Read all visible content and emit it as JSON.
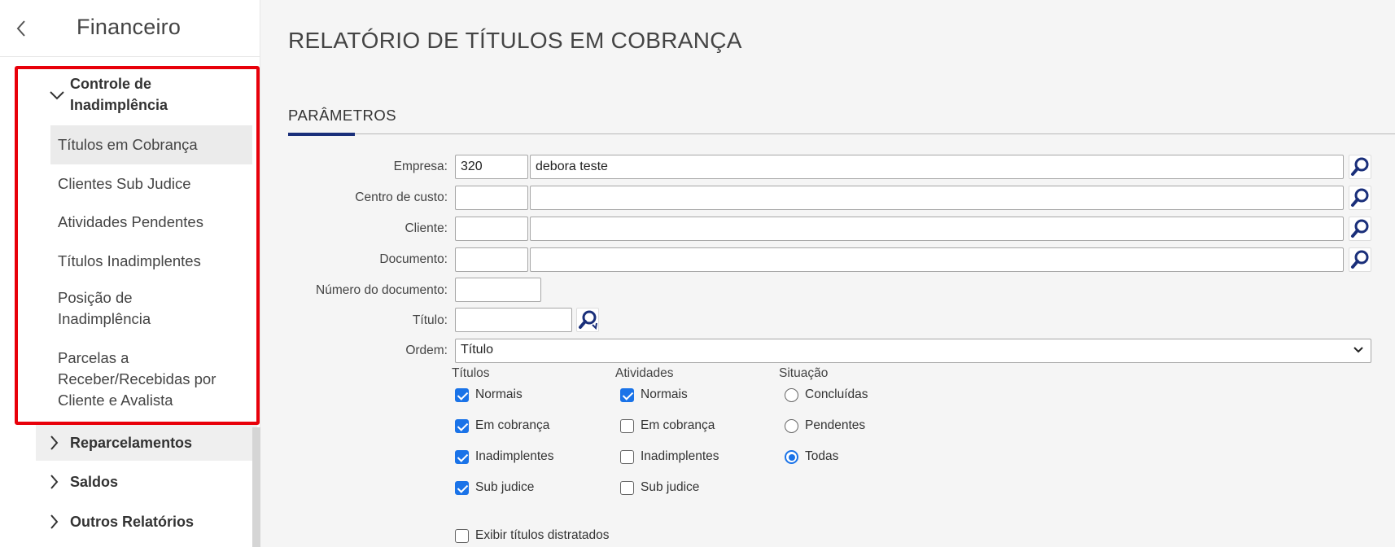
{
  "sidebar": {
    "title": "Financeiro",
    "groups": [
      {
        "label_lines": [
          "Controle de",
          "Inadimplência"
        ],
        "expanded": true,
        "items": [
          {
            "lines": [
              "Títulos em Cobrança"
            ],
            "active": true
          },
          {
            "lines": [
              "Clientes Sub Judice"
            ]
          },
          {
            "lines": [
              "Atividades Pendentes"
            ]
          },
          {
            "lines": [
              "Títulos Inadimplentes"
            ]
          },
          {
            "lines": [
              "Posição de",
              "Inadimplência"
            ]
          },
          {
            "lines": [
              "Parcelas a",
              "Receber/Recebidas por",
              "Cliente e Avalista"
            ]
          }
        ]
      },
      {
        "label": "Reparcelamentos",
        "expanded": false
      },
      {
        "label": "Saldos",
        "expanded": false
      },
      {
        "label": "Outros Relatórios",
        "expanded": false
      }
    ]
  },
  "main": {
    "title": "RELATÓRIO DE TÍTULOS EM COBRANÇA",
    "tab": "PARÂMETROS",
    "fields": {
      "empresa": {
        "label": "Empresa:",
        "code": "320",
        "name": "debora teste"
      },
      "centro_custo": {
        "label": "Centro de custo:",
        "code": "",
        "name": ""
      },
      "cliente": {
        "label": "Cliente:",
        "code": "",
        "name": ""
      },
      "documento": {
        "label": "Documento:",
        "code": "",
        "name": ""
      },
      "numero_documento": {
        "label": "Número do documento:",
        "value": ""
      },
      "titulo": {
        "label": "Título:",
        "value": ""
      },
      "ordem": {
        "label": "Ordem:",
        "value": "Título"
      }
    },
    "titulos": {
      "header": "Títulos",
      "options": [
        {
          "label": "Normais",
          "checked": true
        },
        {
          "label": "Em cobrança",
          "checked": true
        },
        {
          "label": "Inadimplentes",
          "checked": true
        },
        {
          "label": "Sub judice",
          "checked": true
        }
      ]
    },
    "atividades": {
      "header": "Atividades",
      "options": [
        {
          "label": "Normais",
          "checked": true
        },
        {
          "label": "Em cobrança",
          "checked": false
        },
        {
          "label": "Inadimplentes",
          "checked": false
        },
        {
          "label": "Sub judice",
          "checked": false
        }
      ]
    },
    "situacao": {
      "header": "Situação",
      "options": [
        {
          "label": "Concluídas",
          "selected": false
        },
        {
          "label": "Pendentes",
          "selected": false
        },
        {
          "label": "Todas",
          "selected": true
        }
      ]
    },
    "exibir_distratados": {
      "label": "Exibir títulos distratados",
      "checked": false
    }
  },
  "colors": {
    "accent": "#1a2f7a",
    "checkbox": "#1a73e8",
    "highlight_border": "#e8000a",
    "lupa_icon": "#1a2f7a"
  },
  "icons": {
    "back": "chevron-left-icon",
    "lookup": "magnifier-icon",
    "title_lookup": "magnifier-refresh-icon",
    "dropdown": "chevron-down-icon"
  }
}
